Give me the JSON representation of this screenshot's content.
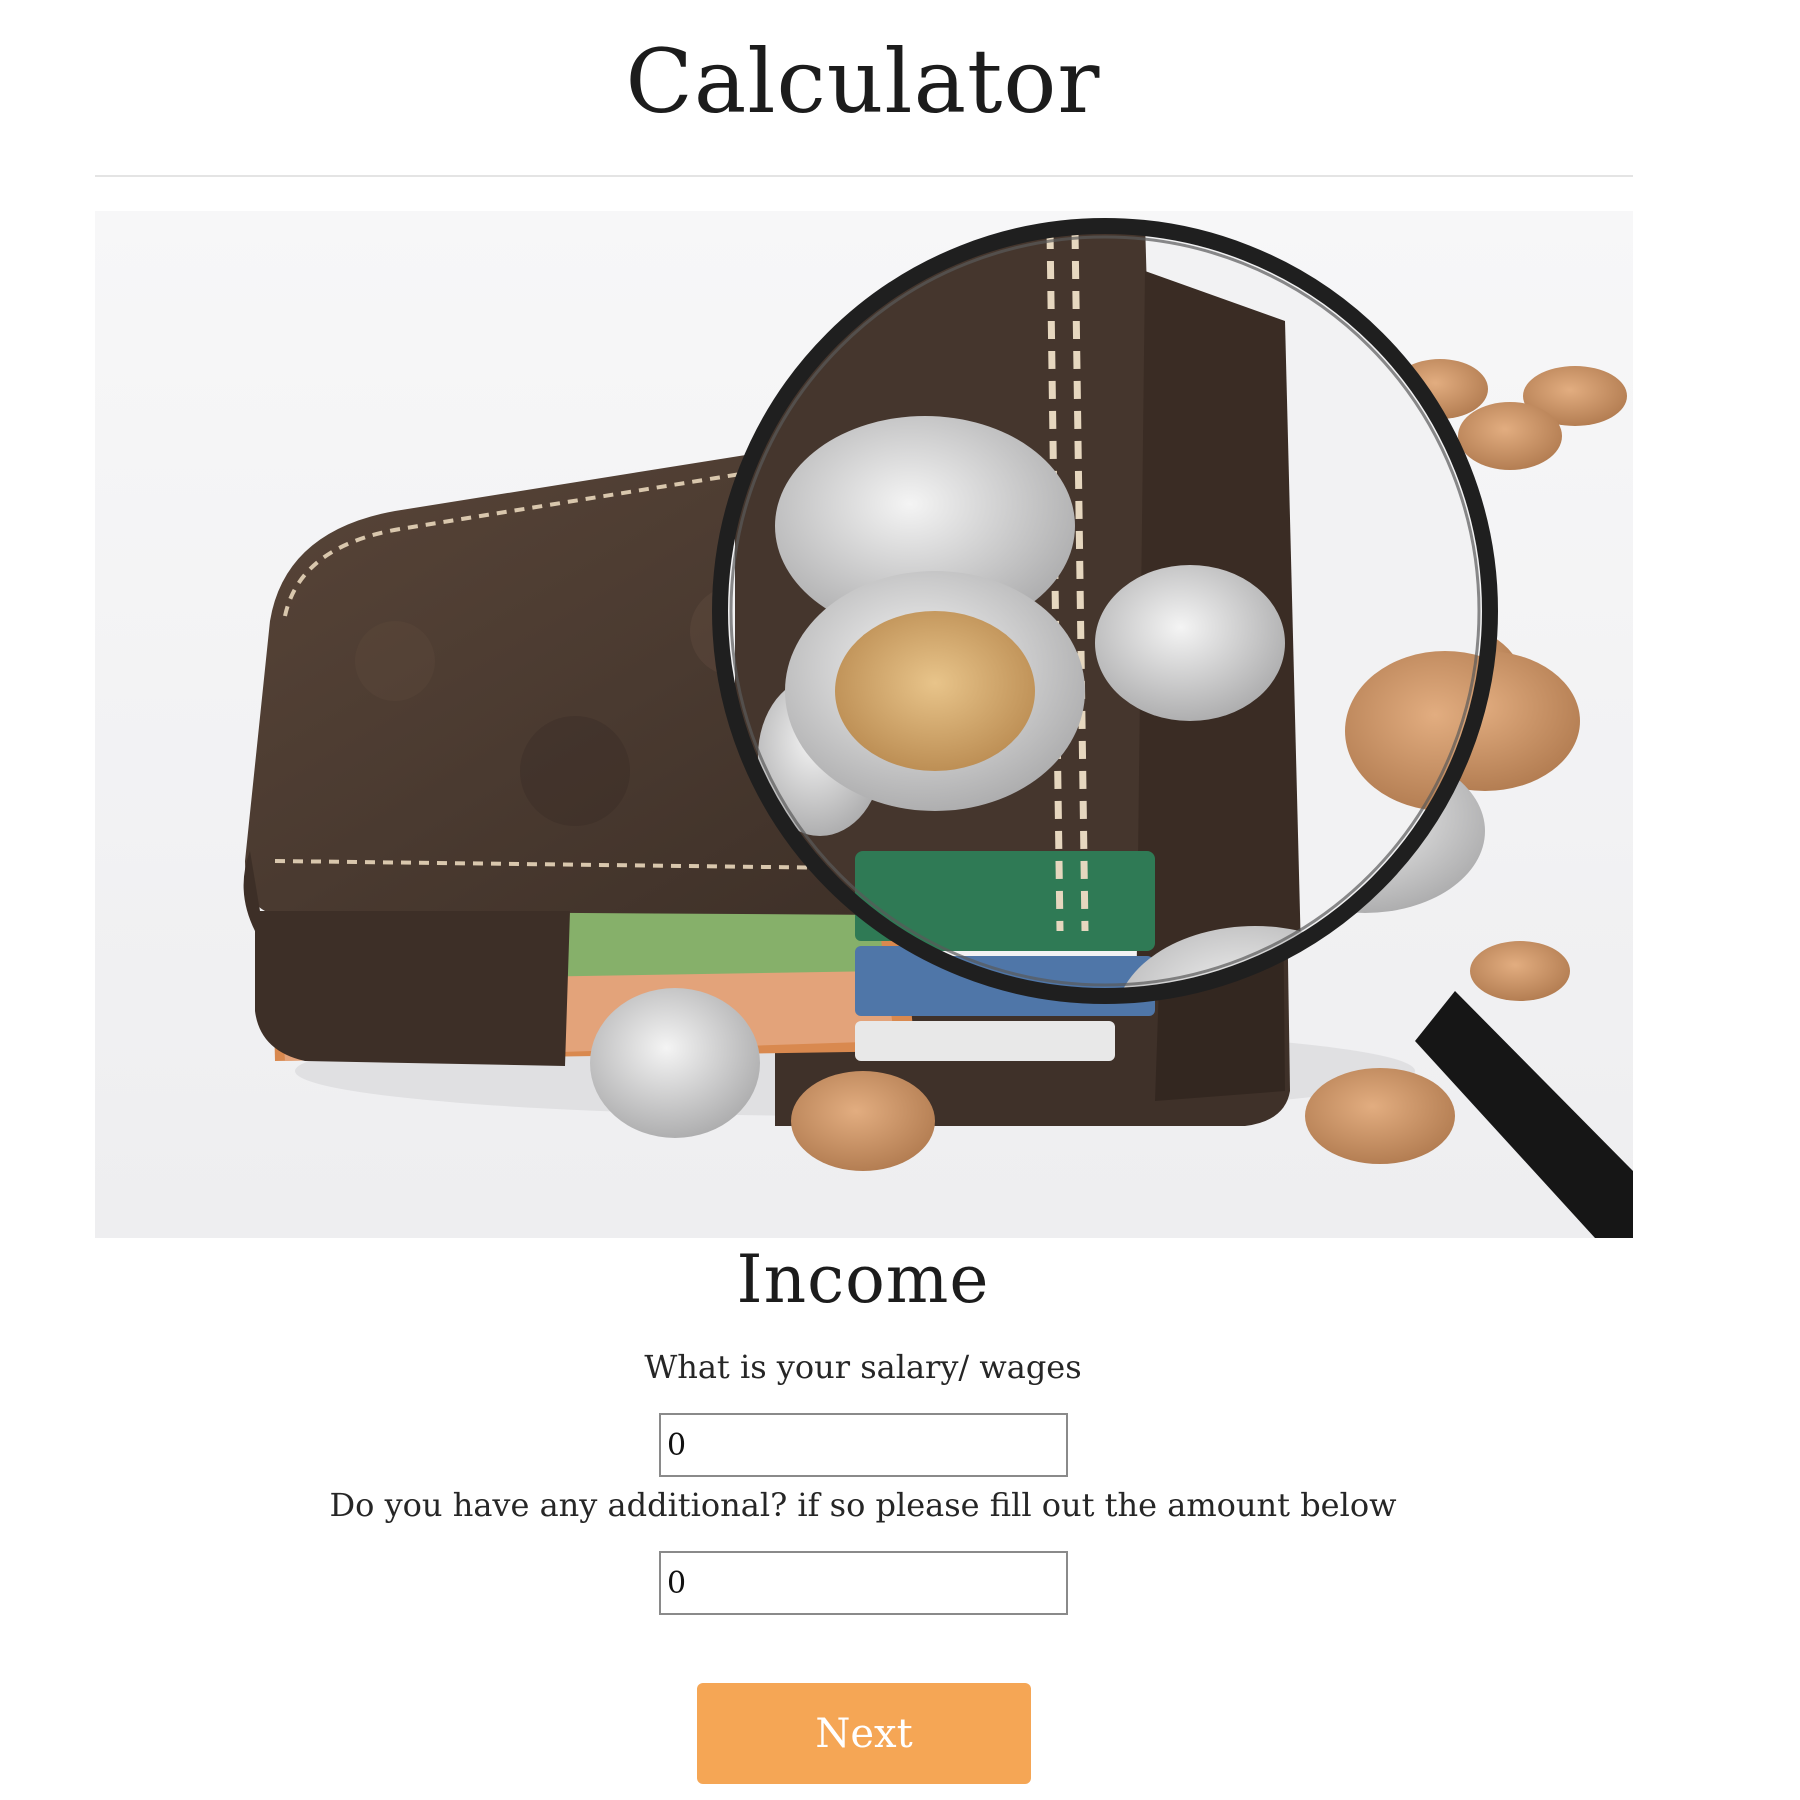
{
  "page": {
    "title": "Calculator"
  },
  "hero": {
    "image_description": "wallet-with-coins-and-magnifying-glass"
  },
  "income": {
    "heading": "Income",
    "salary": {
      "label": "What is your salary/ wages",
      "value": "0"
    },
    "additional": {
      "label": "Do you have any additional? if so please fill out the amount below",
      "value": "0"
    }
  },
  "actions": {
    "next_label": "Next"
  },
  "colors": {
    "button": "#f5a655",
    "divider": "#e4e4e4",
    "wallet": "#4a3a30"
  }
}
